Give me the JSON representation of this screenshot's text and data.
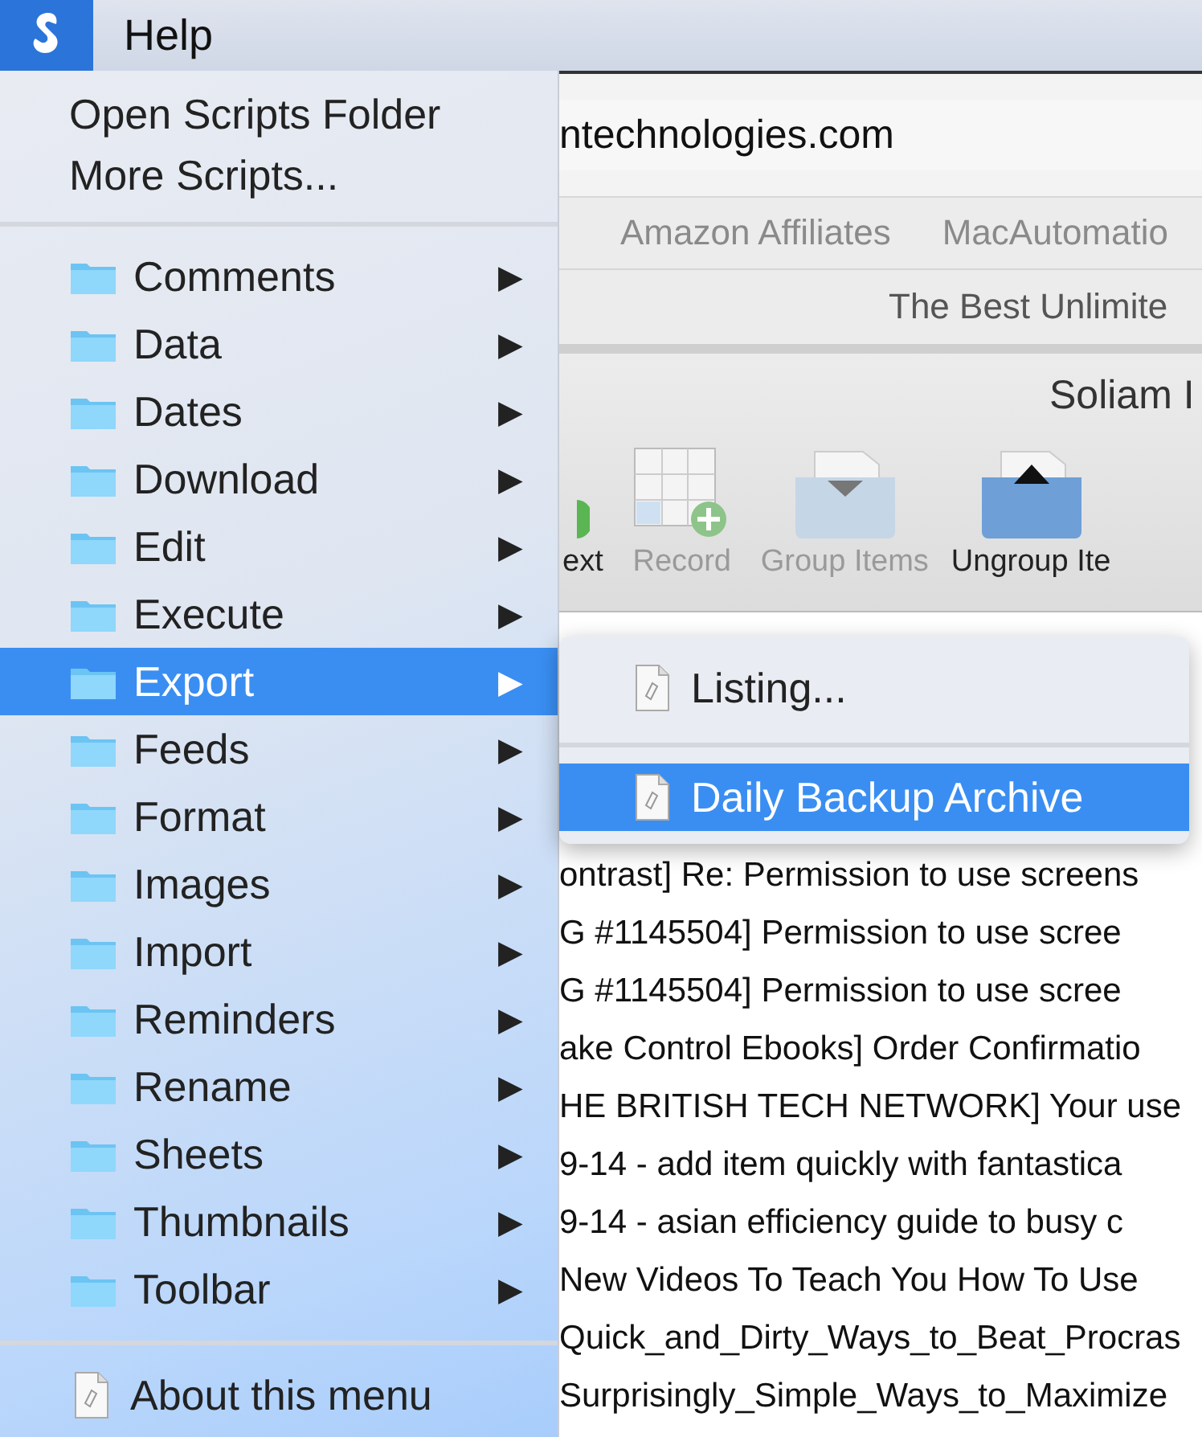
{
  "menu_bar": {
    "app_menu": {
      "selected": true
    },
    "items": [
      {
        "label": "Help",
        "selected": false
      }
    ]
  },
  "script_menu": {
    "top_items": [
      "Open Scripts Folder",
      "More Scripts..."
    ],
    "folders": [
      {
        "label": "Comments",
        "selected": false
      },
      {
        "label": "Data",
        "selected": false
      },
      {
        "label": "Dates",
        "selected": false
      },
      {
        "label": "Download",
        "selected": false
      },
      {
        "label": "Edit",
        "selected": false
      },
      {
        "label": "Execute",
        "selected": false
      },
      {
        "label": "Export",
        "selected": true
      },
      {
        "label": "Feeds",
        "selected": false
      },
      {
        "label": "Format",
        "selected": false
      },
      {
        "label": "Images",
        "selected": false
      },
      {
        "label": "Import",
        "selected": false
      },
      {
        "label": "Reminders",
        "selected": false
      },
      {
        "label": "Rename",
        "selected": false
      },
      {
        "label": "Sheets",
        "selected": false
      },
      {
        "label": "Thumbnails",
        "selected": false
      },
      {
        "label": "Toolbar",
        "selected": false
      }
    ],
    "submenu_arrow": "▶",
    "bottom_item": "About this menu"
  },
  "submenu": {
    "items": [
      {
        "label": "Listing...",
        "selected": false
      },
      {
        "label": "Daily Backup Archive",
        "selected": true
      }
    ]
  },
  "background_window": {
    "address": "ntechnologies.com",
    "bookmarks": [
      "Amazon Affiliates",
      "MacAutomatio"
    ],
    "banner": "The Best Unlimite",
    "title": "Soliam I",
    "toolbar": [
      {
        "label": "ext",
        "kind": "partial",
        "disabled": false
      },
      {
        "label": "Record",
        "kind": "record",
        "disabled": true
      },
      {
        "label": "Group Items",
        "kind": "group",
        "disabled": true
      },
      {
        "label": "Ungroup Ite",
        "kind": "ungroup",
        "disabled": false
      }
    ],
    "rows": [
      "ontrast] Re: Permission to use screens",
      "G #1145504] Permission to use scree",
      "G #1145504] Permission to use scree",
      "ake Control Ebooks] Order Confirmatio",
      "HE BRITISH TECH NETWORK] Your use",
      "9-14 - add item quickly with fantastica",
      "9-14 - asian efficiency guide to busy c",
      "New Videos To Teach You How To Use",
      "Quick_and_Dirty_Ways_to_Beat_Procras",
      "Surprisingly_Simple_Ways_to_Maximize"
    ]
  }
}
